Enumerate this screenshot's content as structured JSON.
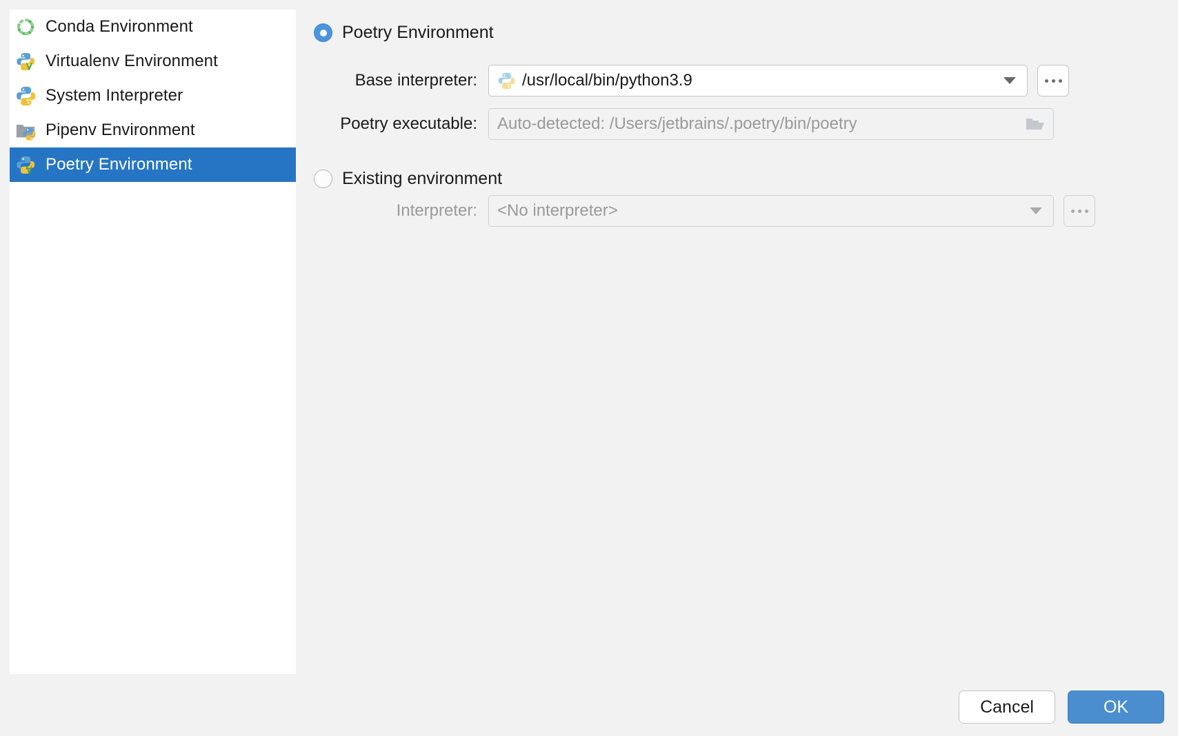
{
  "sidebar": {
    "items": [
      {
        "label": "Conda Environment",
        "icon": "conda-icon",
        "selected": false
      },
      {
        "label": "Virtualenv Environment",
        "icon": "virtualenv-icon",
        "selected": false
      },
      {
        "label": "System Interpreter",
        "icon": "python-icon",
        "selected": false
      },
      {
        "label": "Pipenv Environment",
        "icon": "pipenv-icon",
        "selected": false
      },
      {
        "label": "Poetry Environment",
        "icon": "poetry-icon",
        "selected": true
      }
    ]
  },
  "main": {
    "new_env": {
      "radio_label": "Poetry Environment",
      "selected": true,
      "base_interpreter": {
        "label": "Base interpreter:",
        "value": "/usr/local/bin/python3.9",
        "icon": "python-icon",
        "dropdown_icon": "chevron-down-icon",
        "browse_label": "..."
      },
      "poetry_executable": {
        "label": "Poetry executable:",
        "value": "",
        "placeholder": "Auto-detected: /Users/jetbrains/.poetry/bin/poetry",
        "browse_icon": "folder-icon"
      }
    },
    "existing_env": {
      "radio_label": "Existing environment",
      "selected": false,
      "interpreter": {
        "label": "Interpreter:",
        "value": "<No interpreter>",
        "disabled": true,
        "dropdown_icon": "chevron-down-icon",
        "browse_label": "..."
      }
    }
  },
  "footer": {
    "cancel_label": "Cancel",
    "ok_label": "OK"
  },
  "colors": {
    "selection_blue": "#2675c4",
    "accent_blue": "#4a94e0",
    "ok_button": "#4a8ed0",
    "panel_bg": "#f2f2f2",
    "list_bg": "#ffffff",
    "muted_text": "#9a9a9a"
  }
}
